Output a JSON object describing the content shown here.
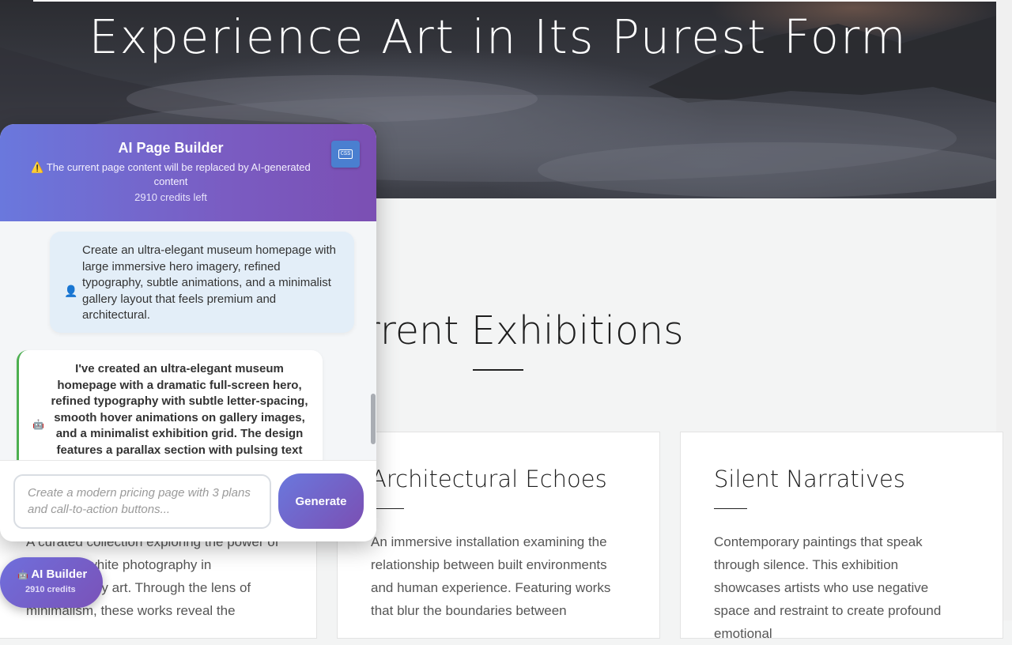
{
  "hero": {
    "title": "Experience Art in Its Purest Form"
  },
  "exhibitions": {
    "title": "Current Exhibitions",
    "cards": [
      {
        "title": "",
        "description": "A curated collection exploring the power of black and white photography in contemporary art. Through the lens of minimalism, these works reveal the"
      },
      {
        "title": "Architectural Echoes",
        "description": "An immersive installation examining the relationship between built environments and human experience. Featuring works that blur the boundaries between"
      },
      {
        "title": "Silent Narratives",
        "description": "Contemporary paintings that speak through silence. This exhibition showcases artists who use negative space and restraint to create profound emotional"
      }
    ]
  },
  "builder": {
    "title": "AI Page Builder",
    "warning": "⚠️ The current page content will be replaced by AI-generated content",
    "credits": "2910 credits left",
    "css_label": "CSS",
    "messages": {
      "user": "Create an ultra-elegant museum homepage with large immersive hero imagery, refined typography, subtle animations, and a minimalist gallery layout that feels premium and architectural.",
      "bot": "I've created an ultra-elegant museum homepage with a dramatic full-screen hero, refined typography with subtle letter-spacing, smooth hover animations on gallery images, and a minimalist exhibition grid. The design features a parallax section with pulsing text"
    },
    "input_placeholder": "Create a modern pricing page with 3 plans and call-to-action buttons...",
    "generate_label": "Generate"
  },
  "launcher": {
    "label": "AI Builder",
    "credits": "2910 credits"
  },
  "icons": {
    "user": "person-icon",
    "bot": "robot-icon",
    "css": "css-file-icon",
    "warning": "warning-icon"
  },
  "colors": {
    "accent_start": "#6a78dd",
    "accent_end": "#7b4fb3",
    "bot_border": "#4caf50"
  }
}
